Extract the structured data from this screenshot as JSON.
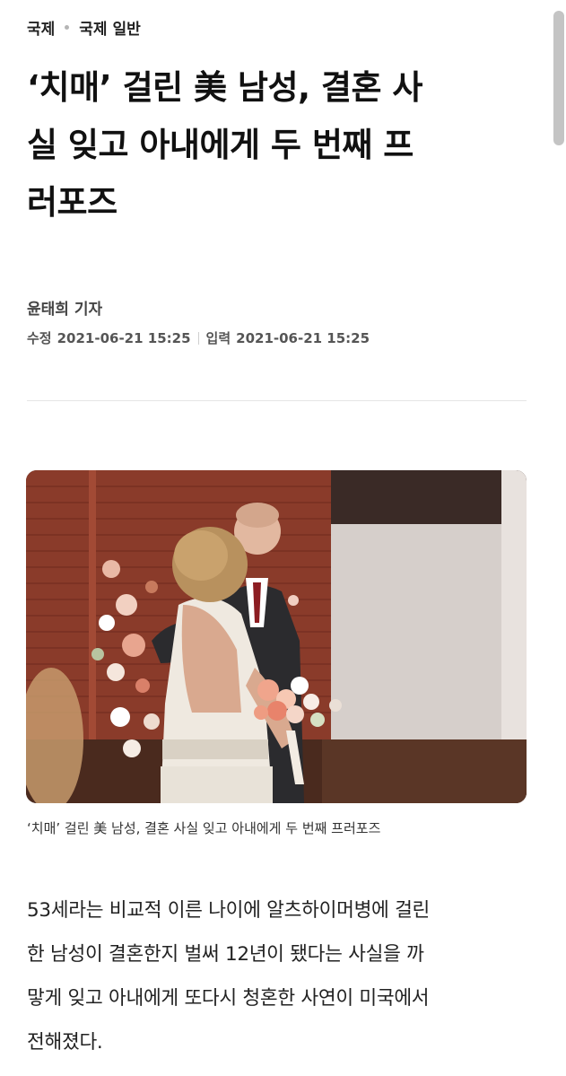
{
  "breadcrumb": {
    "section": "국제",
    "subsection": "국제 일반"
  },
  "article": {
    "headline_lines": [
      "‘치매’ 걸린 美 남성, 결혼 사",
      "실 잊고 아내에게 두 번째 프",
      "러포즈"
    ],
    "reporter": "윤태희 기자",
    "modified_label": "수정",
    "modified_date": "2021-06-21 15:25",
    "published_label": "입력",
    "published_date": "2021-06-21 15:25",
    "caption": "‘치매’ 걸린 美 남성, 결혼 사실 잊고 아내에게 두 번째 프러포즈",
    "body_lines": [
      "53세라는 비교적 이른 나이에 알츠하이머병에 걸린",
      "한 남성이 결혼한지 벌써 12년이 됐다는 사실을 까",
      "맣게 잊고 아내에게 또다시 청혼한 사연이 미국에서",
      "전해졌다."
    ]
  },
  "colors": {
    "brick": "#8a3b2a",
    "wall": "#d8d2cf",
    "floor": "#4a2a1e"
  }
}
